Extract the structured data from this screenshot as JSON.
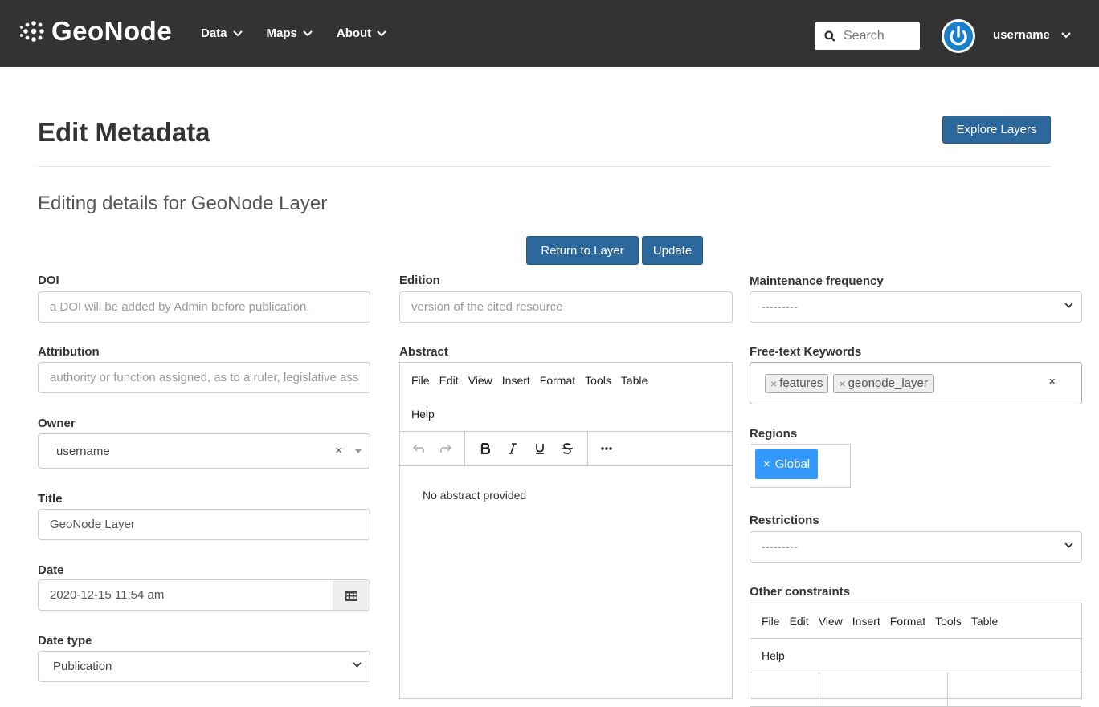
{
  "navbar": {
    "brand": "GeoNode",
    "menu": [
      {
        "label": "Data"
      },
      {
        "label": "Maps"
      },
      {
        "label": "About"
      }
    ],
    "search_placeholder": "Search",
    "username": "username"
  },
  "header": {
    "title": "Edit Metadata",
    "explore_button": "Explore Layers",
    "subtitle": "Editing details for GeoNode Layer"
  },
  "actions": {
    "return_button": "Return to Layer",
    "update_button": "Update"
  },
  "left": {
    "doi": {
      "label": "DOI",
      "placeholder": "a DOI will be added by Admin before publication."
    },
    "attribution": {
      "label": "Attribution",
      "placeholder": "authority or function assigned, as to a ruler, legislative assembly, delegate, or the like"
    },
    "owner": {
      "label": "Owner",
      "value": "username",
      "clear": "×"
    },
    "title": {
      "label": "Title",
      "value": "GeoNode Layer"
    },
    "date": {
      "label": "Date",
      "value": "2020-12-15 11:54 am"
    },
    "date_type": {
      "label": "Date type",
      "value": "Publication"
    }
  },
  "middle": {
    "edition": {
      "label": "Edition",
      "placeholder": "version of the cited resource"
    },
    "abstract": {
      "label": "Abstract",
      "menu": [
        "File",
        "Edit",
        "View",
        "Insert",
        "Format",
        "Tools",
        "Table"
      ],
      "menu_help": "Help",
      "content": "No abstract provided"
    }
  },
  "right": {
    "maintenance": {
      "label": "Maintenance frequency",
      "value": "---------"
    },
    "keywords": {
      "label": "Free-text Keywords",
      "tags": [
        "features",
        "geonode_layer"
      ],
      "clear": "×"
    },
    "regions": {
      "label": "Regions",
      "tag": "Global"
    },
    "restrictions": {
      "label": "Restrictions",
      "value": "---------"
    },
    "other_constraints": {
      "label": "Other constraints",
      "menu": [
        "File",
        "Edit",
        "View",
        "Insert",
        "Format",
        "Tools",
        "Table"
      ],
      "menu_help": "Help"
    }
  },
  "icons": {
    "brand": "geonode-logo-icon",
    "search": "search-icon",
    "avatar": "power-icon",
    "calendar": "calendar-icon"
  },
  "colors": {
    "navbar": "#333333",
    "primary": "#2c689c",
    "region_tag": "#3399ff"
  }
}
